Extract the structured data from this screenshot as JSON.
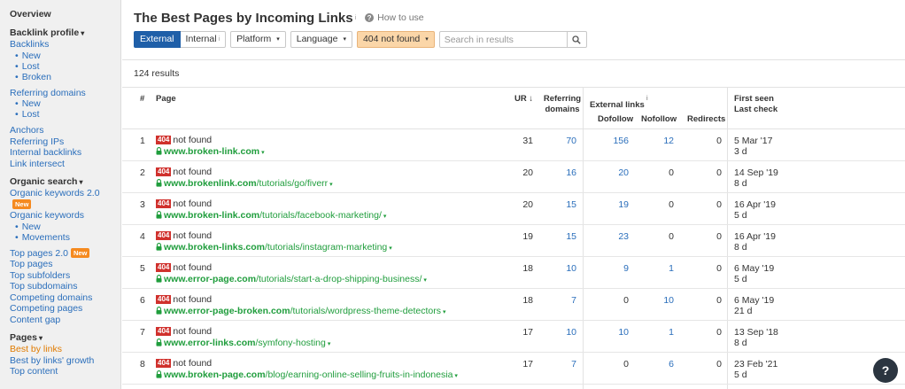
{
  "sidebar": {
    "overview": "Overview",
    "backlink_profile": "Backlink profile",
    "backlinks": "Backlinks",
    "backlinks_sub": [
      "New",
      "Lost",
      "Broken"
    ],
    "referring_domains": "Referring domains",
    "referring_domains_sub": [
      "New",
      "Lost"
    ],
    "anchors": "Anchors",
    "referring_ips": "Referring IPs",
    "internal_backlinks": "Internal backlinks",
    "link_intersect": "Link intersect",
    "organic_search": "Organic search",
    "organic_keywords_2": "Organic keywords 2.0",
    "new_badge": "New",
    "organic_keywords": "Organic keywords",
    "organic_keywords_sub": [
      "New",
      "Movements"
    ],
    "top_pages_2": "Top pages 2.0",
    "top_pages": "Top pages",
    "top_subfolders": "Top subfolders",
    "top_subdomains": "Top subdomains",
    "competing_domains": "Competing domains",
    "competing_pages": "Competing pages",
    "content_gap": "Content gap",
    "pages": "Pages",
    "best_by_links": "Best by links",
    "best_by_links_growth": "Best by links' growth",
    "top_content": "Top content"
  },
  "header": {
    "title": "The Best Pages by Incoming Links",
    "info_mark": "i",
    "how_to_use": "How to use",
    "help_glyph": "?"
  },
  "filters": {
    "external": "External",
    "internal": "Internal",
    "internal_mark": "i",
    "platform": "Platform",
    "language": "Language",
    "status": "404 not found",
    "search_placeholder": "Search in results",
    "caret": "▾"
  },
  "results_count": "124 results",
  "columns": {
    "num": "#",
    "page": "Page",
    "ur": "UR",
    "ur_sort": "↓",
    "referring": "Referring",
    "domains": "domains",
    "external_links": "External links",
    "ext_mark": "i",
    "dofollow": "Dofollow",
    "nofollow": "Nofollow",
    "redirects": "Redirects",
    "first_seen": "First seen",
    "last_check": "Last check"
  },
  "rows": [
    {
      "num": "1",
      "badge": "404",
      "status": "not found",
      "domain": "www.broken-link.com",
      "path": "",
      "ur": "31",
      "ref": "70",
      "dofollow": "156",
      "nofollow": "12",
      "redirects": "0",
      "first_seen": "5 Mar '17",
      "last_check": "3 d"
    },
    {
      "num": "2",
      "badge": "404",
      "status": "not found",
      "domain": "www.brokenlink.com",
      "path": "/tutorials/go/fiverr",
      "ur": "20",
      "ref": "16",
      "dofollow": "20",
      "nofollow": "0",
      "redirects": "0",
      "first_seen": "14 Sep '19",
      "last_check": "8 d"
    },
    {
      "num": "3",
      "badge": "404",
      "status": "not found",
      "domain": "www.broken-link.com",
      "path": "/tutorials/facebook-marketing/",
      "ur": "20",
      "ref": "15",
      "dofollow": "19",
      "nofollow": "0",
      "redirects": "0",
      "first_seen": "16 Apr '19",
      "last_check": "5 d"
    },
    {
      "num": "4",
      "badge": "404",
      "status": "not found",
      "domain": "www.broken-links.com",
      "path": "/tutorials/instagram-marketing",
      "ur": "19",
      "ref": "15",
      "dofollow": "23",
      "nofollow": "0",
      "redirects": "0",
      "first_seen": "16 Apr '19",
      "last_check": "8 d"
    },
    {
      "num": "5",
      "badge": "404",
      "status": "not found",
      "domain": "www.error-page.com",
      "path": "/tutorials/start-a-drop-shipping-business/",
      "ur": "18",
      "ref": "10",
      "dofollow": "9",
      "nofollow": "1",
      "redirects": "0",
      "first_seen": "6 May '19",
      "last_check": "5 d"
    },
    {
      "num": "6",
      "badge": "404",
      "status": "not found",
      "domain": "www.error-page-broken.com",
      "path": "/tutorials/wordpress-theme-detectors",
      "ur": "18",
      "ref": "7",
      "dofollow": "0",
      "nofollow": "10",
      "redirects": "0",
      "first_seen": "6 May '19",
      "last_check": "21 d"
    },
    {
      "num": "7",
      "badge": "404",
      "status": "not found",
      "domain": "www.error-links.com",
      "path": "/symfony-hosting",
      "ur": "17",
      "ref": "10",
      "dofollow": "10",
      "nofollow": "1",
      "redirects": "0",
      "first_seen": "13 Sep '18",
      "last_check": "8 d"
    },
    {
      "num": "8",
      "badge": "404",
      "status": "not found",
      "domain": "www.broken-page.com",
      "path": "/blog/earning-online-selling-fruits-in-indonesia",
      "ur": "17",
      "ref": "7",
      "dofollow": "0",
      "nofollow": "6",
      "redirects": "0",
      "first_seen": "23 Feb '21",
      "last_check": "5 d"
    }
  ],
  "colors": {
    "accent": "#1f5fa8",
    "link": "#2a6ebb",
    "url_green": "#1f9d3c",
    "badge_red": "#d0312d",
    "active_orange": "#e07b00",
    "filter_orange": "#fbd6a8"
  },
  "icons": [
    "question-icon",
    "search-icon",
    "lock-icon",
    "caret-down-icon",
    "help-icon"
  ]
}
